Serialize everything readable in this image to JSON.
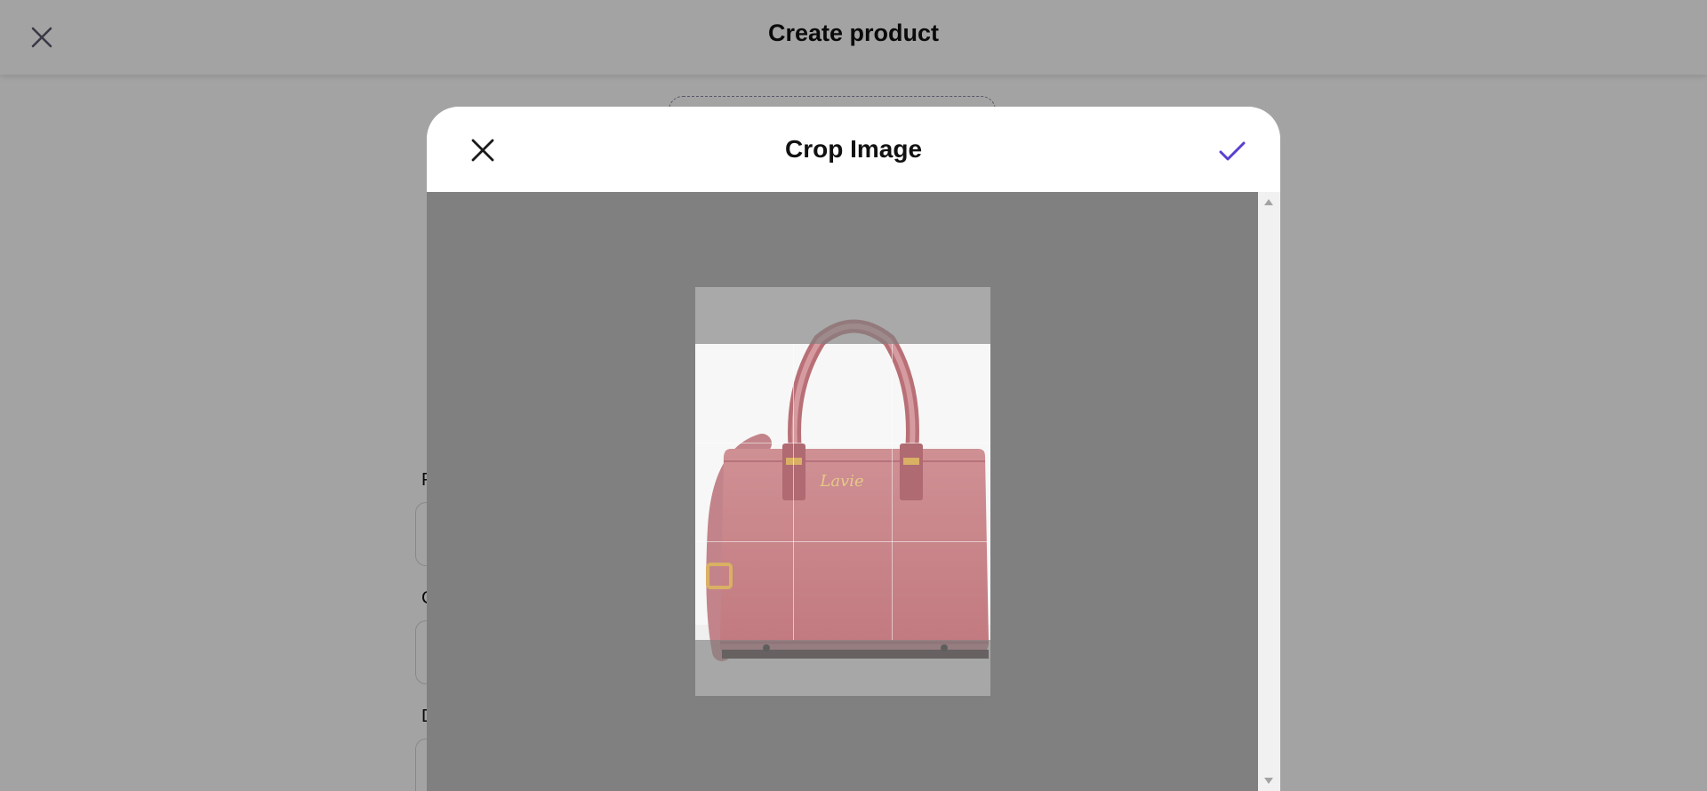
{
  "page": {
    "title": "Create product",
    "field_labels": [
      "P",
      "C",
      "D"
    ]
  },
  "modal": {
    "title": "Crop Image"
  },
  "icons": {
    "page_close": "close-icon",
    "modal_close": "close-icon",
    "confirm": "check-icon"
  },
  "colors": {
    "accent": "#5a3fd1",
    "crop_background": "#808080",
    "bag": "#c98a8e"
  }
}
